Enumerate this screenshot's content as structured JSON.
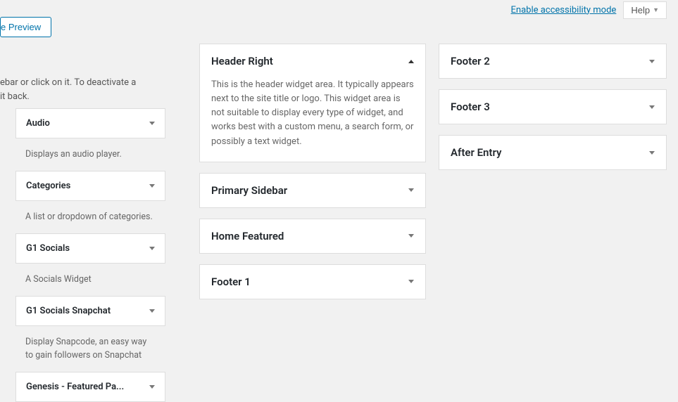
{
  "top": {
    "accessibility_link": "Enable accessibility mode",
    "help_label": "Help"
  },
  "preview_button_label": "e Preview",
  "instructions": {
    "line1": "ebar or click on it. To deactivate a",
    "line2": " it back."
  },
  "widgets": [
    {
      "title": "Audio",
      "desc": "Displays an audio player."
    },
    {
      "title": "Categories",
      "desc": "A list or dropdown of categories."
    },
    {
      "title": "G1 Socials",
      "desc": "A Socials Widget"
    },
    {
      "title": "G1 Socials Snapchat",
      "desc": "Display Snapcode, an easy way to gain followers on Snapchat"
    },
    {
      "title": "Genesis - Featured Pa...",
      "desc": ""
    }
  ],
  "areas_mid": [
    {
      "title": "Header Right",
      "expanded": true,
      "desc": "This is the header widget area. It typically appears next to the site title or logo. This widget area is not suitable to display every type of widget, and works best with a custom menu, a search form, or possibly a text widget."
    },
    {
      "title": "Primary Sidebar",
      "expanded": false
    },
    {
      "title": "Home Featured",
      "expanded": false
    },
    {
      "title": "Footer 1",
      "expanded": false
    }
  ],
  "areas_right": [
    {
      "title": "Footer 2",
      "expanded": false
    },
    {
      "title": "Footer 3",
      "expanded": false
    },
    {
      "title": "After Entry",
      "expanded": false
    }
  ]
}
